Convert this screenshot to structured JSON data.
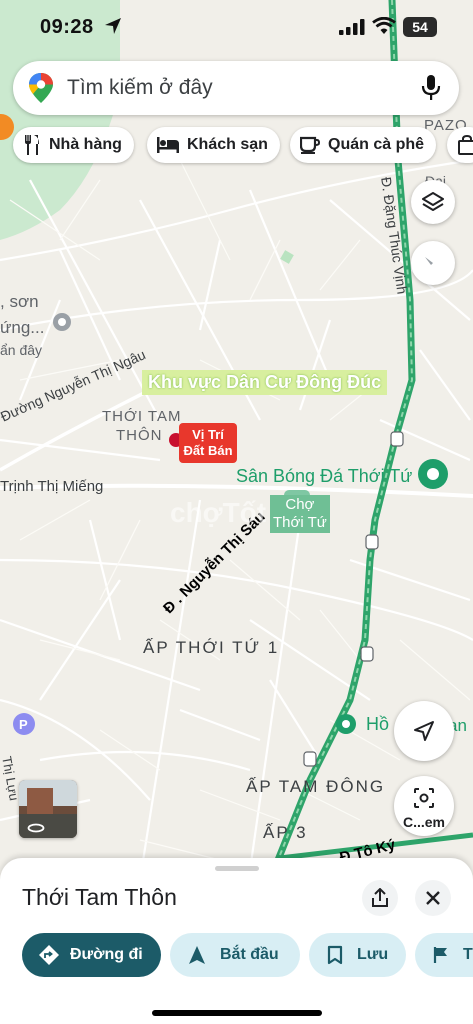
{
  "status_bar": {
    "time": "09:28",
    "battery": "54"
  },
  "search": {
    "placeholder": "Tìm kiếm ở đây"
  },
  "chips": [
    {
      "label": "Nhà hàng",
      "icon": "fork-knife-icon"
    },
    {
      "label": "Khách sạn",
      "icon": "bed-icon"
    },
    {
      "label": "Quán cà phê",
      "icon": "coffee-cup-icon"
    }
  ],
  "map": {
    "annotation_area": "Khu vực Dân Cư Đông Đúc",
    "marker_label_line1": "Vị Trí",
    "marker_label_line2": "Đất Bán",
    "annotation_street": "Đ . Nguyễn Thị Sáu",
    "annotation_street_2": "Đ Tô Ký",
    "labels": {
      "thoi_tam_line1": "THỚI TAM",
      "thoi_tam_line2": "THÔN",
      "nguyen_thi_ngau": "Đường Nguyễn Thị Ngâu",
      "trinh_thi_mieng": "Trịnh Thị Miếng",
      "san_bong": "Sân Bóng Đá Thới Tứ",
      "cho_line1": "Chợ",
      "cho_line2": "Thới Tứ",
      "ap_thoi_tu": "ẤP THỚI TỨ 1",
      "ap_tam_dong": "ẤP TAM ĐÔNG",
      "ap_3": "ẤP 3",
      "dang_thuc_vinh": "Đ. Đặng Thúc Vịnh",
      "ho": "Hồ",
      "son": ", sơn",
      "ung": "ứng...",
      "day": "ẩn đây",
      "partial_pazo": "PAZO",
      "partial_dai": "Đại",
      "partial_lan": "an",
      "partial_thi": "Thị Lựu",
      "watermark": "chợTốt"
    }
  },
  "buttons": {
    "street_view": "C...em"
  },
  "sheet": {
    "title": "Thới Tam Thôn",
    "actions": [
      {
        "label": "Đường đi",
        "icon": "directions-icon"
      },
      {
        "label": "Bắt đầu",
        "icon": "navigation-arrow-icon"
      },
      {
        "label": "Lưu",
        "icon": "bookmark-icon"
      },
      {
        "label": "T",
        "icon": "flag-icon"
      }
    ]
  },
  "colors": {
    "route": "#2ea46a",
    "marker": "#e8372c",
    "annotation_bg": "#d8ef9f",
    "map_bg": "#f1efe9",
    "primary_button": "#1c5b68",
    "secondary_button": "#d8eef4"
  }
}
